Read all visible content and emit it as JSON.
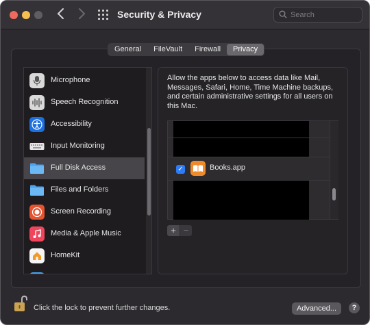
{
  "window": {
    "title": "Security & Privacy"
  },
  "search": {
    "placeholder": "Search"
  },
  "tabs": [
    {
      "label": "General"
    },
    {
      "label": "FileVault"
    },
    {
      "label": "Firewall"
    },
    {
      "label": "Privacy",
      "active": true
    }
  ],
  "sidebar": {
    "items": [
      {
        "label": "Microphone",
        "icon": "microphone-icon",
        "color": "#d9d9d9"
      },
      {
        "label": "Speech Recognition",
        "icon": "speech-recognition-icon",
        "color": "#d9d9d9"
      },
      {
        "label": "Accessibility",
        "icon": "accessibility-icon",
        "color": "#1c6fe0"
      },
      {
        "label": "Input Monitoring",
        "icon": "keyboard-icon",
        "color": "#e6e6e6"
      },
      {
        "label": "Full Disk Access",
        "icon": "folder-icon",
        "color": "#4aa3f0",
        "selected": true
      },
      {
        "label": "Files and Folders",
        "icon": "folder-icon",
        "color": "#4aa3f0"
      },
      {
        "label": "Screen Recording",
        "icon": "screen-recording-icon",
        "color": "#e5532f"
      },
      {
        "label": "Media & Apple Music",
        "icon": "music-icon",
        "color": "#f0455b"
      },
      {
        "label": "HomeKit",
        "icon": "home-icon",
        "color": "#f5f5f5"
      }
    ]
  },
  "main": {
    "description": "Allow the apps below to access data like Mail, Messages, Safari, Home, Time Machine backups, and certain administrative settings for all users on this Mac.",
    "apps": [
      {
        "name": "Books.app",
        "checked": true,
        "icon": "books-icon",
        "color": "#ef8a2c"
      }
    ],
    "add_label": "+",
    "remove_label": "−"
  },
  "footer": {
    "lock_text": "Click the lock to prevent further changes.",
    "advanced_label": "Advanced...",
    "help_label": "?"
  }
}
